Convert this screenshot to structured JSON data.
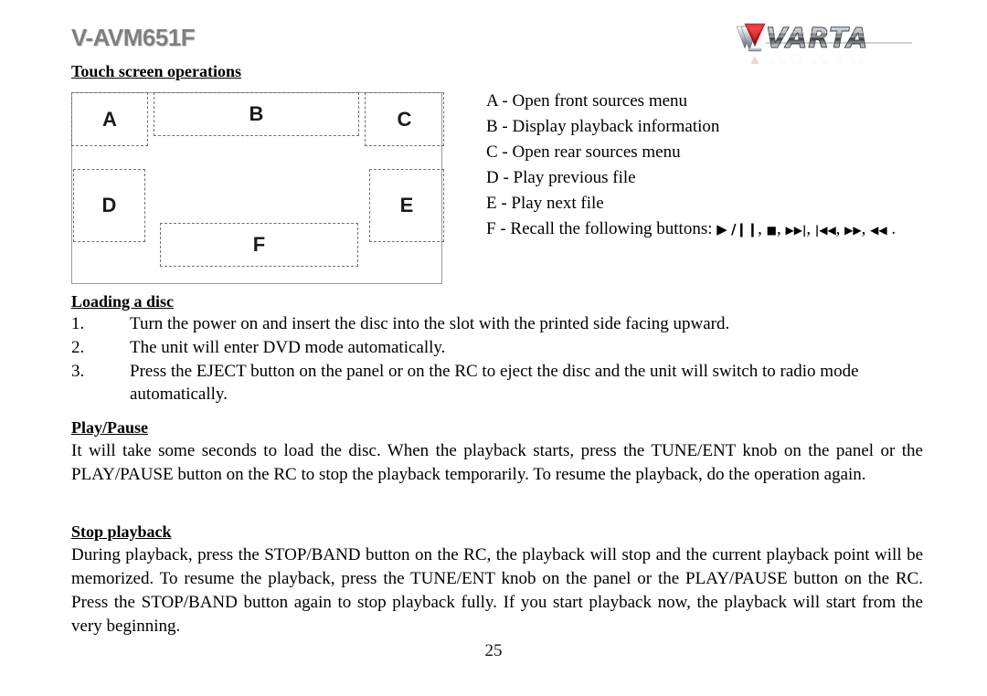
{
  "header": {
    "model_title": "V-AVM651F",
    "logo_text": "VARTA",
    "logo_colors": {
      "triangle_red": "#d8161d",
      "chrome_light": "#f2f2f2",
      "chrome_mid": "#9a9fa4",
      "chrome_dark": "#4a5055"
    }
  },
  "sections": {
    "touch_screen": {
      "heading": "Touch screen operations"
    },
    "loading_disc": {
      "heading": "Loading a disc",
      "steps": [
        {
          "number": "1.",
          "text": "Turn the power on and insert the disc into the slot with the printed side facing upward."
        },
        {
          "number": "2.",
          "text": "The unit will enter DVD mode automatically."
        },
        {
          "number": "3.",
          "text": "Press the EJECT button on the panel or on the RC to eject the disc and the unit will switch to radio mode automatically."
        }
      ]
    },
    "play_pause": {
      "heading": "Play/Pause",
      "body": "It will take some seconds to load the disc. When the playback starts, press the TUNE/ENT knob on the panel or the PLAY/PAUSE button on the RC to stop the playback temporarily. To resume the playback, do the operation again."
    },
    "stop_playback": {
      "heading": "Stop playback",
      "body": "During playback, press the STOP/BAND button on the RC, the playback will stop and the current playback point will be memorized. To resume the playback, press the TUNE/ENT knob on the panel or the PLAY/PAUSE button on the RC. Press the STOP/BAND button again to stop playback fully. If you start playback now, the playback will start from the very beginning."
    }
  },
  "diagram": {
    "zones": [
      {
        "id": "A",
        "label": "A"
      },
      {
        "id": "B",
        "label": "B"
      },
      {
        "id": "C",
        "label": "C"
      },
      {
        "id": "D",
        "label": "D"
      },
      {
        "id": "E",
        "label": "E"
      },
      {
        "id": "F",
        "label": "F"
      }
    ]
  },
  "legend": {
    "rows": [
      {
        "key": "A",
        "text": "A - Open front sources menu"
      },
      {
        "key": "B",
        "text": "B - Display playback information"
      },
      {
        "key": "C",
        "text": "C - Open rear sources menu"
      },
      {
        "key": "D",
        "text": "D - Play previous file"
      },
      {
        "key": "E",
        "text": "E - Play next file"
      }
    ],
    "row_f": {
      "key": "F",
      "prefix": "F - Recall the following buttons: ",
      "symbols": [
        {
          "name": "play-pause-symbol",
          "glyph": "▶ /❙❙",
          "sep": ", "
        },
        {
          "name": "stop-symbol",
          "glyph": "■",
          "sep": ", "
        },
        {
          "name": "next-track-symbol",
          "glyph": "▶▶|",
          "sep": ", "
        },
        {
          "name": "previous-track-symbol",
          "glyph": "|◀◀",
          "sep": ", "
        },
        {
          "name": "fast-forward-symbol",
          "glyph": "▶▶",
          "sep": ", "
        },
        {
          "name": "rewind-symbol",
          "glyph": "◀◀",
          "sep": " ."
        }
      ]
    }
  },
  "footer": {
    "page_number": "25"
  }
}
